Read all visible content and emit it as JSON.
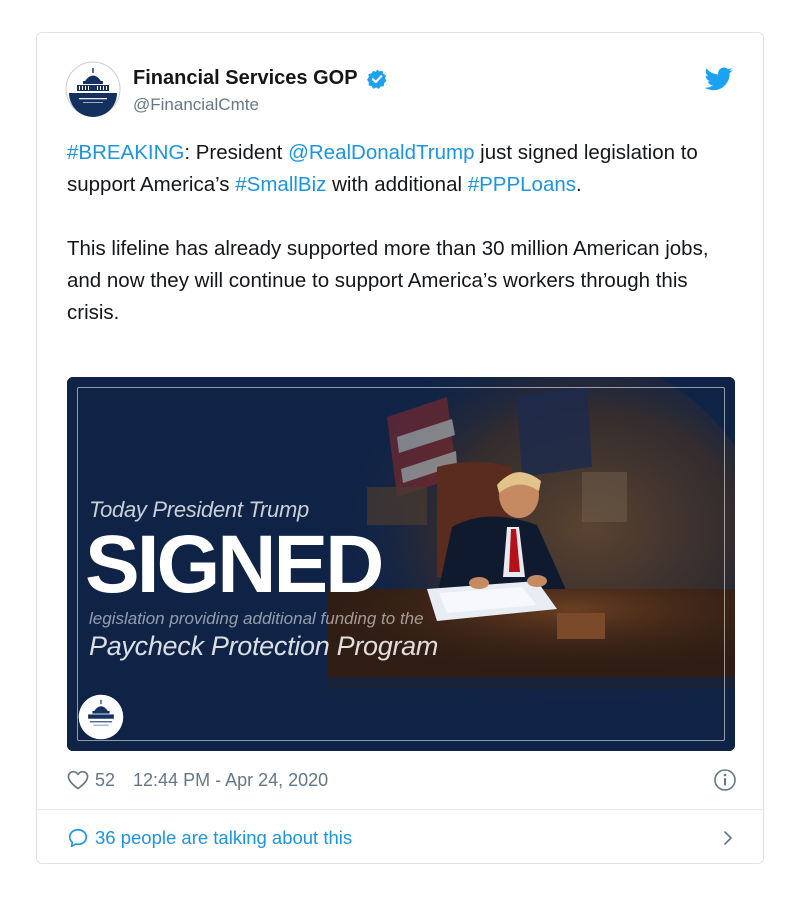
{
  "author": {
    "name": "Financial Services GOP",
    "handle": "@FinancialCmte",
    "avatar_text": "FINANCIAL SERVICES"
  },
  "tweet": {
    "p1": [
      {
        "text": "#BREAKING",
        "link": true
      },
      {
        "text": ": President ",
        "link": false
      },
      {
        "text": "@RealDonaldTrump",
        "link": true
      },
      {
        "text": " just signed legislation to support America’s ",
        "link": false
      },
      {
        "text": "#SmallBiz",
        "link": true
      },
      {
        "text": " with additional ",
        "link": false
      },
      {
        "text": "#PPPLoans",
        "link": true
      },
      {
        "text": ".",
        "link": false
      }
    ],
    "p2": "This lifeline has already supported more than 30 million American jobs, and now they will continue to support America’s workers through this crisis."
  },
  "media": {
    "line1": "Today President Trump",
    "headline": "SIGNED",
    "line2": "legislation providing additional funding to the",
    "line3": "Paycheck Protection Program",
    "seal_text": "FINANCIAL SERVICES"
  },
  "meta": {
    "likes": "52",
    "timestamp": "12:44 PM - Apr 24, 2020"
  },
  "talking": {
    "label": "36 people are talking about this"
  },
  "colors": {
    "link": "#1b95e0",
    "text": "#14171a",
    "muted": "#657786",
    "media_bg": "#0f2347",
    "verified": "#1da1f2"
  },
  "icons": {
    "verified": "verified-badge-icon",
    "brand": "twitter-bird-icon",
    "like": "heart-icon",
    "info": "info-icon",
    "reply": "speech-bubble-icon",
    "chevron": "chevron-right-icon"
  }
}
